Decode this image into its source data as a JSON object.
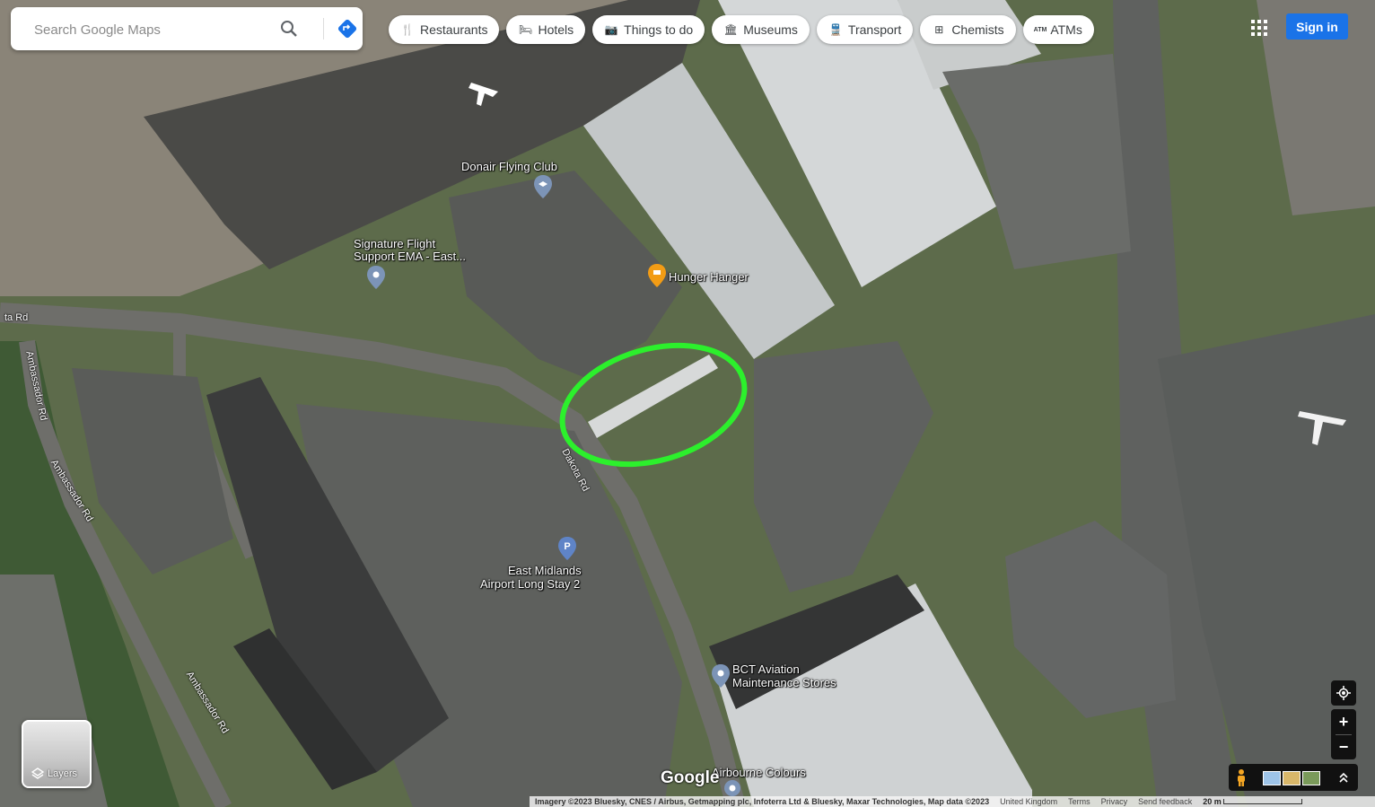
{
  "search": {
    "placeholder": "Search Google Maps"
  },
  "chips": [
    {
      "label": "Restaurants",
      "icon": "fork-knife-icon"
    },
    {
      "label": "Hotels",
      "icon": "bed-icon"
    },
    {
      "label": "Things to do",
      "icon": "camera-icon"
    },
    {
      "label": "Museums",
      "icon": "museum-icon"
    },
    {
      "label": "Transport",
      "icon": "train-icon"
    },
    {
      "label": "Chemists",
      "icon": "pharmacy-icon"
    },
    {
      "label": "ATMs",
      "icon": "atm-icon",
      "prefix": "ATM"
    }
  ],
  "header": {
    "sign_in": "Sign in"
  },
  "places": {
    "donair": "Donair Flying Club",
    "signature_1": "Signature Flight",
    "signature_2": "Support EMA - East...",
    "hunger": "Hunger Hanger",
    "parking_1": "East Midlands",
    "parking_2": "Airport Long Stay 2",
    "bct_1": "BCT Aviation",
    "bct_2": "Maintenance Stores",
    "airbourne": "Airbourne Colours",
    "parking_pin_letter": "P"
  },
  "roads": {
    "dakota_left": "ta Rd",
    "ambassador_1": "Ambassador Rd",
    "ambassador_2": "Ambassador Rd",
    "ambassador_3": "Ambassador Rd",
    "dakota": "Dakota Rd"
  },
  "layers_label": "Layers",
  "google_logo": "Google",
  "footer": {
    "imagery": "Imagery ©2023 Bluesky, CNES / Airbus, Getmapping plc, Infoterra Ltd & Bluesky, Maxar Technologies, Map data ©2023",
    "country": "United Kingdom",
    "terms": "Terms",
    "privacy": "Privacy",
    "feedback": "Send feedback",
    "scale": "20 m"
  },
  "annotation": {
    "color": "#2cf02c"
  },
  "colors": {
    "accent": "#1a73e8",
    "grass": "#5b6a4c",
    "tarmac": "#555a58",
    "roof": "#b8bcbd"
  }
}
